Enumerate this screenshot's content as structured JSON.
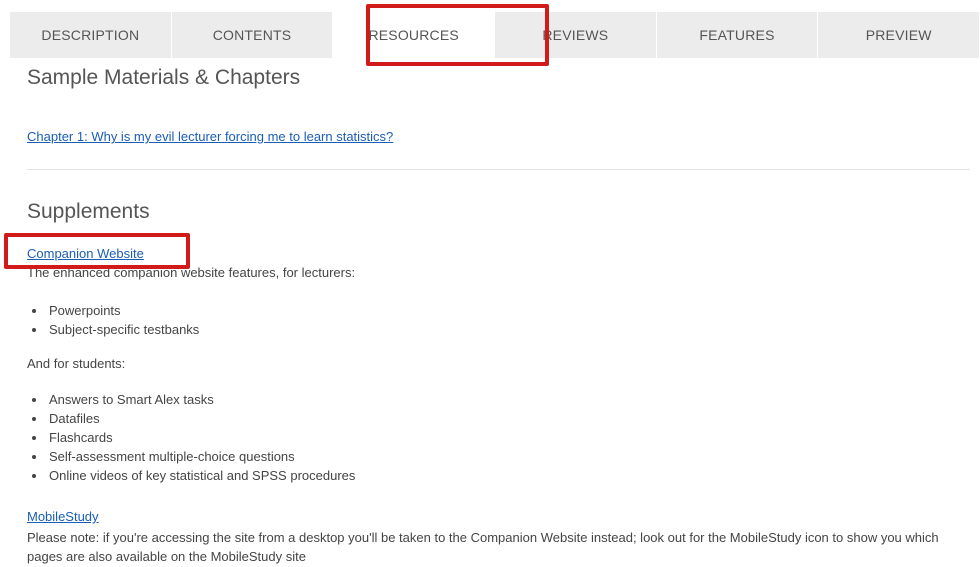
{
  "tabs": [
    {
      "label": "DESCRIPTION"
    },
    {
      "label": "CONTENTS"
    },
    {
      "label": "RESOURCES"
    },
    {
      "label": "REVIEWS"
    },
    {
      "label": "FEATURES"
    },
    {
      "label": "PREVIEW"
    }
  ],
  "active_tab": "RESOURCES",
  "highlight_color": "#d11a1a",
  "link_color": "#1a5db5",
  "sample": {
    "heading": "Sample Materials & Chapters",
    "chapter_link": "Chapter 1: Why is my evil lecturer forcing me to learn statistics?"
  },
  "supplements": {
    "heading": "Supplements",
    "companion_link": "Companion Website",
    "companion_desc": "The enhanced companion website features, for lecturers:",
    "lecturer_items": [
      "Powerpoints",
      "Subject-specific testbanks"
    ],
    "students_label": "And for students:",
    "student_items": [
      "Answers to Smart Alex tasks",
      "Datafiles",
      "Flashcards",
      "Self-assessment multiple-choice questions",
      "Online videos of key statistical and SPSS procedures"
    ],
    "mobile_link": "MobileStudy",
    "mobile_note": "Please note: if you're accessing the site from a desktop you'll be taken to the Companion Website instead; look out for the MobileStudy icon to show you which pages are also available on the MobileStudy site"
  }
}
